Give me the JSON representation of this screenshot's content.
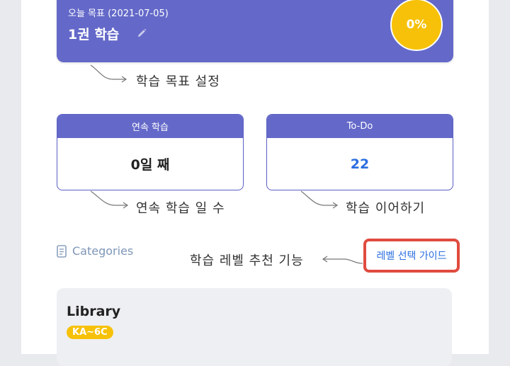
{
  "goal": {
    "date_label": "오늘 목표 (2021-07-05)",
    "title": "1권 학습",
    "progress": "0%",
    "edit_icon": "pencil-icon"
  },
  "annotations": {
    "goal_setting": "학습 목표 설정",
    "streak_days": "연속 학습 일 수",
    "continue_learning": "학습 이어하기",
    "level_recommendation": "학습 레벨 추천 기능"
  },
  "stats": {
    "streak": {
      "label": "연속 학습",
      "value": "0일 째"
    },
    "todo": {
      "label": "To-Do",
      "value": "22"
    }
  },
  "categories": {
    "heading": "Categories",
    "icon": "document-icon",
    "guide_button": "레벨 선택 가이드"
  },
  "library": {
    "title": "Library",
    "badge": "KA~6C"
  },
  "colors": {
    "primary": "#6469c9",
    "accent_yellow": "#f6c108",
    "link_blue": "#2a6ee0",
    "highlight_red": "#e04b3f"
  }
}
